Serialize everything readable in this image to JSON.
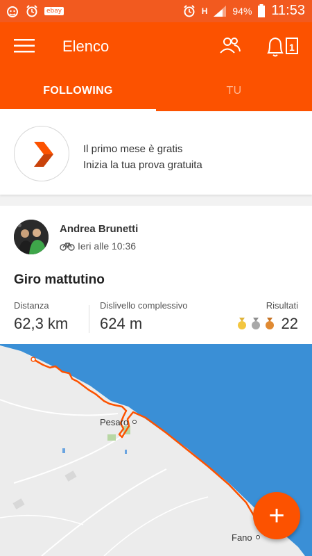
{
  "status_bar": {
    "ebay_label": "ebay",
    "network_label": "H",
    "battery": "94%",
    "time": "11:53"
  },
  "app_bar": {
    "title": "Elenco",
    "notification_count": "1"
  },
  "tabs": [
    {
      "label": "FOLLOWING",
      "active": true
    },
    {
      "label": "TU",
      "active": false
    }
  ],
  "promo": {
    "line1": "Il primo mese è gratis",
    "line2": "Inizia la tua prova gratuita"
  },
  "activity": {
    "athlete": "Andrea Brunetti",
    "time": "Ieri alle 10:36",
    "title": "Giro mattutino",
    "stats": {
      "distance_label": "Distanza",
      "distance_value": "62,3 km",
      "elevation_label": "Dislivello complessivo",
      "elevation_value": "624 m",
      "results_label": "Risultati",
      "results_value": "22"
    }
  },
  "map": {
    "city1": "Pesaro",
    "city2": "Fano"
  },
  "colors": {
    "brand": "#fc5200",
    "sea": "#3a8fd6",
    "land": "#ececec"
  },
  "fab": {
    "icon": "plus-icon"
  }
}
